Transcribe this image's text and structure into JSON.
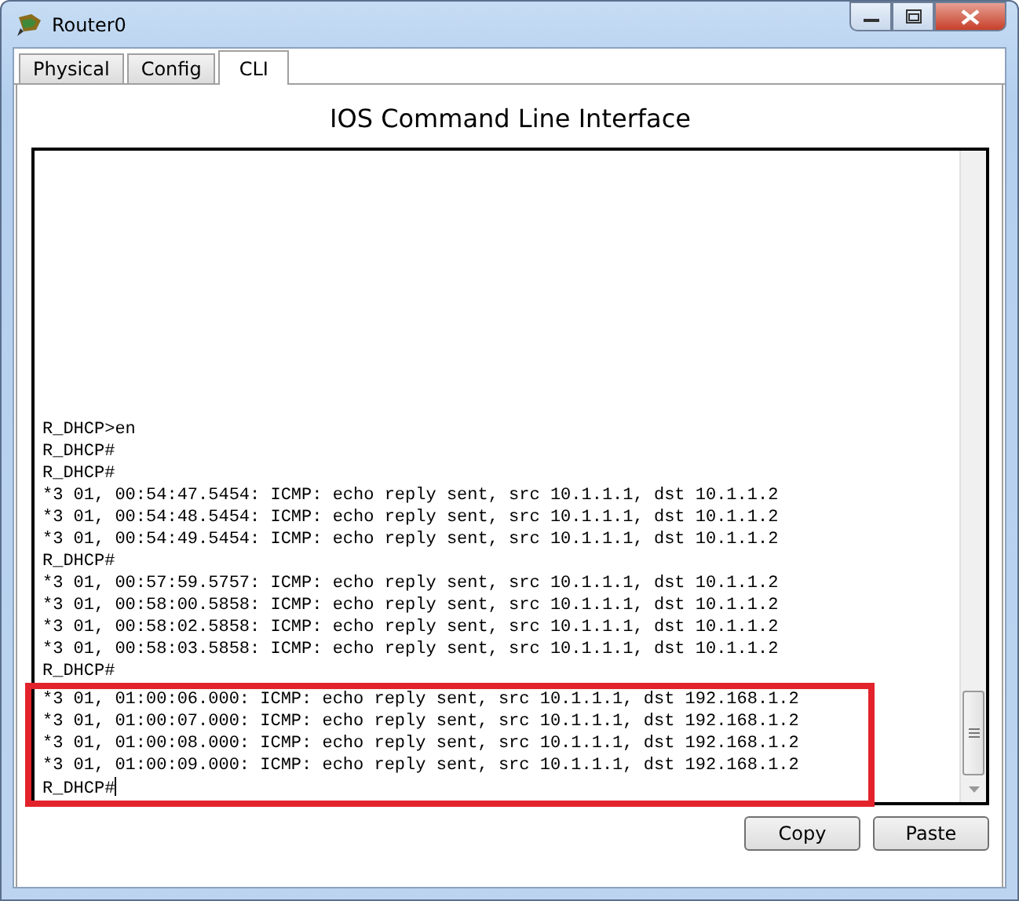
{
  "window": {
    "title": "Router0"
  },
  "tabs": [
    {
      "label": "Physical",
      "selected": false
    },
    {
      "label": "Config",
      "selected": false
    },
    {
      "label": "CLI",
      "selected": true
    }
  ],
  "heading": "IOS Command Line Interface",
  "terminal": {
    "cursor_after_last_line": true,
    "lines": [
      {
        "text": "R_DHCP>en",
        "highlighted": false
      },
      {
        "text": "R_DHCP#",
        "highlighted": false
      },
      {
        "text": "R_DHCP#",
        "highlighted": false
      },
      {
        "text": "*3 01, 00:54:47.5454: ICMP: echo reply sent, src 10.1.1.1, dst 10.1.1.2",
        "highlighted": false
      },
      {
        "text": "*3 01, 00:54:48.5454: ICMP: echo reply sent, src 10.1.1.1, dst 10.1.1.2",
        "highlighted": false
      },
      {
        "text": "*3 01, 00:54:49.5454: ICMP: echo reply sent, src 10.1.1.1, dst 10.1.1.2",
        "highlighted": false
      },
      {
        "text": "R_DHCP#",
        "highlighted": false
      },
      {
        "text": "*3 01, 00:57:59.5757: ICMP: echo reply sent, src 10.1.1.1, dst 10.1.1.2",
        "highlighted": false
      },
      {
        "text": "*3 01, 00:58:00.5858: ICMP: echo reply sent, src 10.1.1.1, dst 10.1.1.2",
        "highlighted": false
      },
      {
        "text": "*3 01, 00:58:02.5858: ICMP: echo reply sent, src 10.1.1.1, dst 10.1.1.2",
        "highlighted": false
      },
      {
        "text": "*3 01, 00:58:03.5858: ICMP: echo reply sent, src 10.1.1.1, dst 10.1.1.2",
        "highlighted": false
      },
      {
        "text": "R_DHCP#",
        "highlighted": false
      },
      {
        "text": "*3 01, 01:00:06.000: ICMP: echo reply sent, src 10.1.1.1, dst 192.168.1.2",
        "highlighted": true
      },
      {
        "text": "*3 01, 01:00:07.000: ICMP: echo reply sent, src 10.1.1.1, dst 192.168.1.2",
        "highlighted": true
      },
      {
        "text": "*3 01, 01:00:08.000: ICMP: echo reply sent, src 10.1.1.1, dst 192.168.1.2",
        "highlighted": true
      },
      {
        "text": "*3 01, 01:00:09.000: ICMP: echo reply sent, src 10.1.1.1, dst 192.168.1.2",
        "highlighted": true
      },
      {
        "text": "R_DHCP#",
        "highlighted": true
      }
    ]
  },
  "buttons": [
    "Copy",
    "Paste"
  ]
}
